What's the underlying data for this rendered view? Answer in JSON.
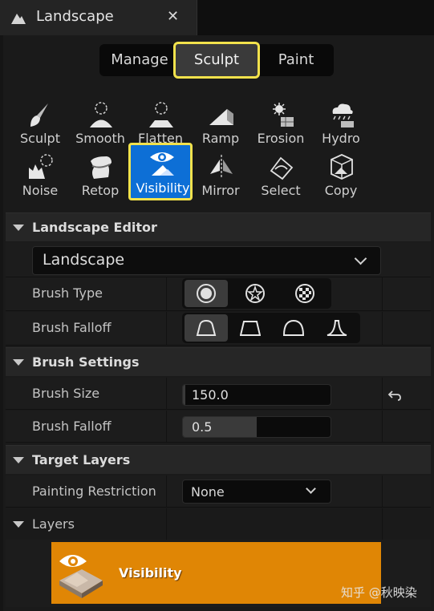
{
  "window": {
    "tab_title": "Landscape",
    "close_glyph": "✕"
  },
  "mode_tabs": [
    {
      "label": "Manage"
    },
    {
      "label": "Sculpt",
      "selected": true
    },
    {
      "label": "Paint"
    }
  ],
  "tools": [
    {
      "label": "Sculpt",
      "icon": "brush-icon"
    },
    {
      "label": "Smooth",
      "icon": "smooth-icon"
    },
    {
      "label": "Flatten",
      "icon": "flatten-icon"
    },
    {
      "label": "Ramp",
      "icon": "ramp-icon"
    },
    {
      "label": "Erosion",
      "icon": "erosion-icon"
    },
    {
      "label": "Hydro",
      "icon": "hydro-icon"
    },
    {
      "label": "Noise",
      "icon": "noise-icon"
    },
    {
      "label": "Retop",
      "icon": "retopologize-icon"
    },
    {
      "label": "Visibility",
      "icon": "visibility-icon",
      "selected": true
    },
    {
      "label": "Mirror",
      "icon": "mirror-icon"
    },
    {
      "label": "Select",
      "icon": "select-icon"
    },
    {
      "label": "Copy",
      "icon": "copy-icon"
    }
  ],
  "sections": {
    "landscape_editor": "Landscape Editor",
    "brush_settings": "Brush Settings",
    "target_layers": "Target Layers"
  },
  "landscape_select": {
    "value": "Landscape"
  },
  "brush_type": {
    "label": "Brush Type",
    "options": [
      "circle-brush-icon",
      "alpha-brush-icon",
      "pattern-brush-icon"
    ],
    "selected": 0
  },
  "brush_falloff_shape": {
    "label": "Brush Falloff",
    "options": [
      "smooth-falloff-icon",
      "linear-falloff-icon",
      "spherical-falloff-icon",
      "tip-falloff-icon"
    ],
    "selected": 0
  },
  "brush_size": {
    "label": "Brush Size",
    "value": "150.0",
    "fraction": 0.01
  },
  "brush_falloff_amount": {
    "label": "Brush Falloff",
    "value": "0.5",
    "fraction": 0.5
  },
  "painting_restriction": {
    "label": "Painting Restriction",
    "value": "None"
  },
  "layers": {
    "label": "Layers",
    "items": [
      {
        "name": "Visibility"
      }
    ]
  },
  "watermark": "知乎 @秋映染",
  "colors": {
    "accent": "#f2e24c",
    "selected_tool": "#0d6fd6",
    "layer_highlight": "#e08605"
  }
}
